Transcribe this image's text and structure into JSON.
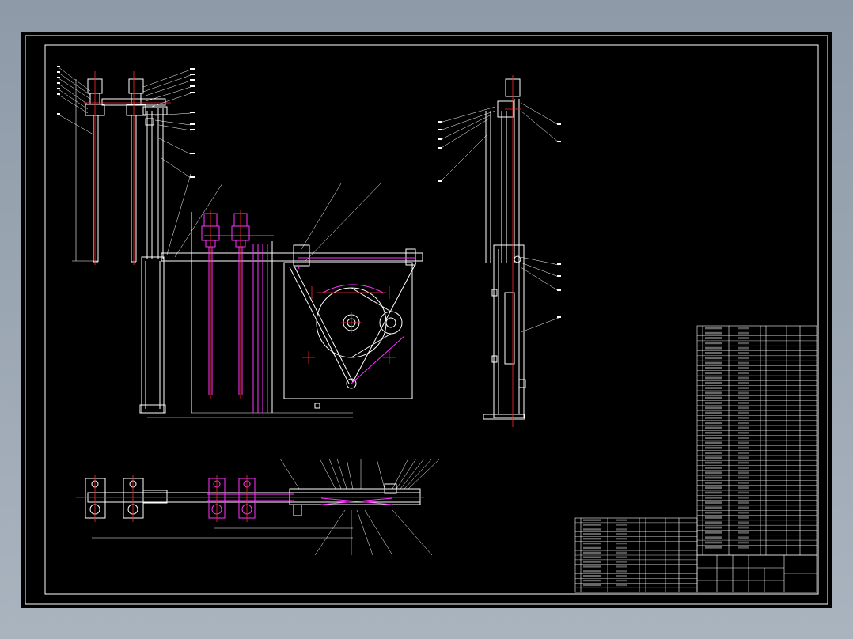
{
  "viewer": {
    "background_color": "#000000",
    "frame_color": "#8e9aa8"
  },
  "colors": {
    "outline": "#ffffff",
    "center_line": "#ff2a2a",
    "highlight": "#ff33ff",
    "dimension": "#ffffff"
  },
  "title_block": {
    "parts_rows_upper": 46,
    "parts_rows_lower": 16
  }
}
